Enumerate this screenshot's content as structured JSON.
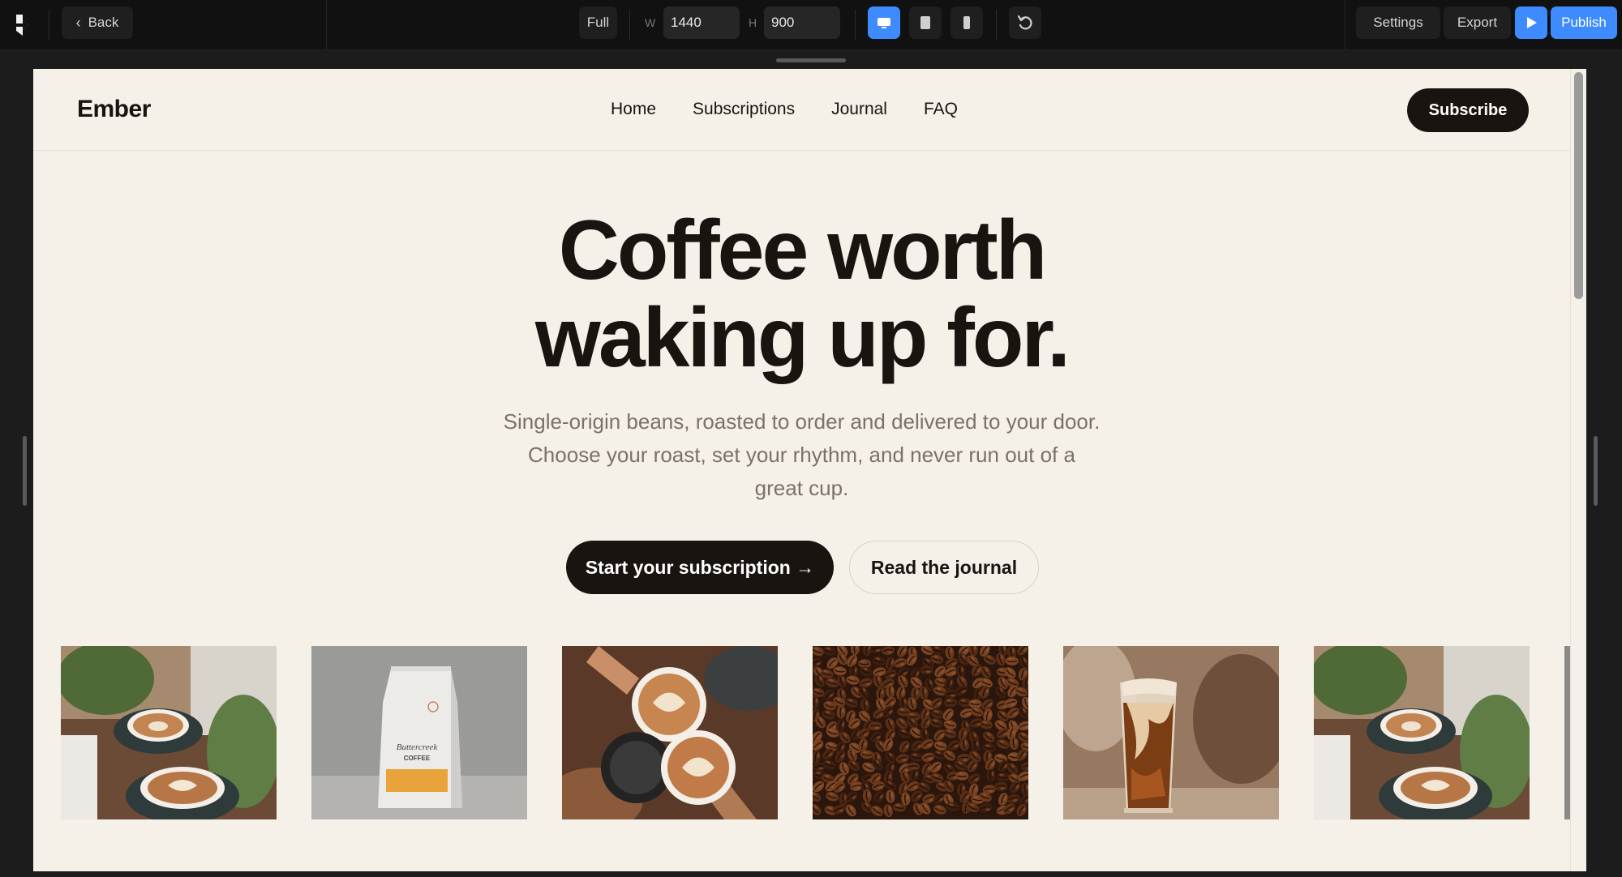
{
  "toolbar": {
    "back_label": "Back",
    "viewport_mode": "Full",
    "width_label": "W",
    "width_value": "1440",
    "height_label": "H",
    "height_value": "900",
    "settings_label": "Settings",
    "export_label": "Export",
    "publish_label": "Publish",
    "accent_color": "#3d8bff"
  },
  "site": {
    "brand": "Ember",
    "nav": [
      "Home",
      "Subscriptions",
      "Journal",
      "FAQ"
    ],
    "subscribe_label": "Subscribe",
    "hero_line1": "Coffee worth",
    "hero_line2": "waking up for.",
    "hero_sub_1": "Single-origin beans, roasted to order and delivered to your door.",
    "hero_sub_2": "Choose your roast, set your rhythm, and never run out of a",
    "hero_sub_3": "great cup.",
    "cta_primary": "Start your subscription →",
    "cta_secondary": "Read the journal",
    "bag_text": "Buttercreek COFFEE",
    "gallery": [
      "latte-cups-with-plants",
      "coffee-bag",
      "cheers-latte-cups",
      "coffee-beans",
      "iced-coffee-glass",
      "latte-cups-with-plants"
    ]
  }
}
